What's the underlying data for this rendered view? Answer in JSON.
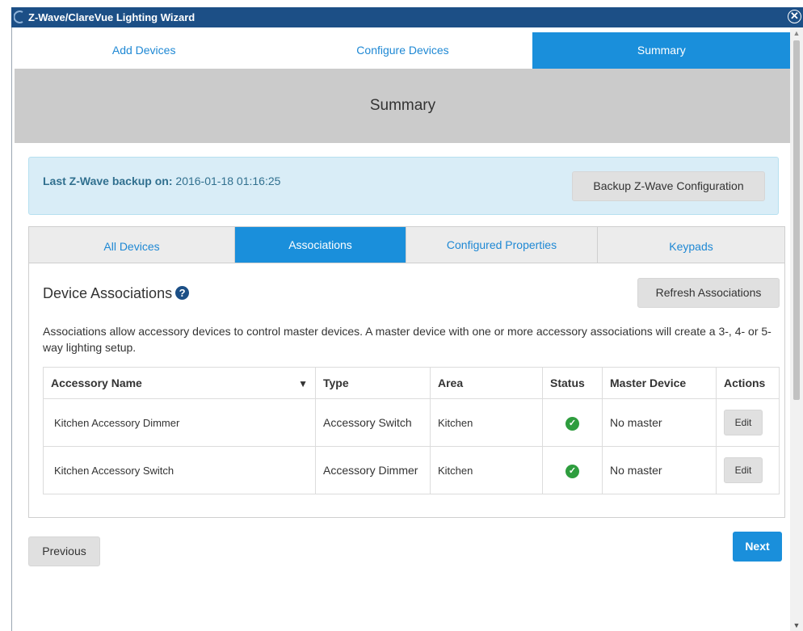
{
  "window": {
    "title": "Z-Wave/ClareVue Lighting Wizard"
  },
  "wizard_tabs": [
    {
      "label": "Add Devices",
      "active": false
    },
    {
      "label": "Configure Devices",
      "active": false
    },
    {
      "label": "Summary",
      "active": true
    }
  ],
  "header": {
    "title": "Summary"
  },
  "backup": {
    "label": "Last Z-Wave backup on:",
    "value": "2016-01-18 01:16:25",
    "button_label": "Backup Z-Wave Configuration"
  },
  "subtabs": [
    {
      "label": "All Devices",
      "active": false
    },
    {
      "label": "Associations",
      "active": true
    },
    {
      "label": "Configured Properties",
      "active": false
    },
    {
      "label": "Keypads",
      "active": false
    }
  ],
  "panel": {
    "title": "Device Associations",
    "help_icon": "question-circle-icon",
    "refresh_label": "Refresh Associations",
    "description": "Associations allow accessory devices to control master devices. A master device with one or more accessory associations will create a 3-, 4- or 5-way lighting setup."
  },
  "table": {
    "columns": [
      "Accessory Name",
      "Type",
      "Area",
      "Status",
      "Master Device",
      "Actions"
    ],
    "sort_icon": "caret-down-icon",
    "rows": [
      {
        "name": "Kitchen Accessory Dimmer",
        "type": "Accessory Switch",
        "area": "Kitchen",
        "status_icon": "check-circle-icon",
        "master": "No master",
        "action": "Edit"
      },
      {
        "name": "Kitchen Accessory Switch",
        "type": "Accessory Dimmer",
        "area": "Kitchen",
        "status_icon": "check-circle-icon",
        "master": "No master",
        "action": "Edit"
      }
    ]
  },
  "footer": {
    "previous_label": "Previous",
    "next_label": "Next"
  },
  "colors": {
    "accent": "#1a8fdb",
    "titlebar": "#1c4f86",
    "success": "#2e9d3e",
    "info_bg": "#d9edf7"
  }
}
